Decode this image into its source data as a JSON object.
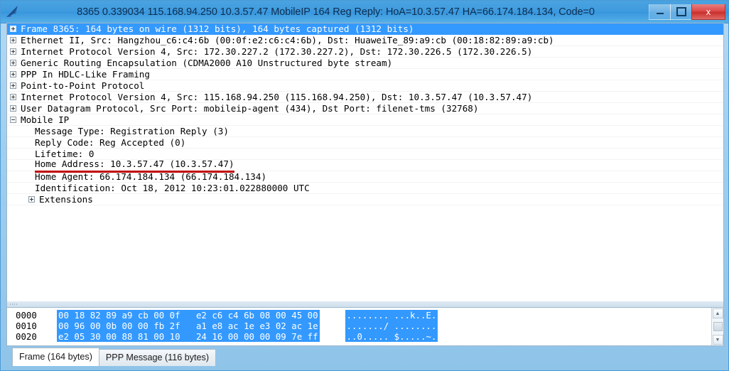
{
  "window": {
    "title": "8365 0.339034 115.168.94.250 10.3.57.47 MobileIP 164 Reg Reply: HoA=10.3.57.47 HA=66.174.184.134, Code=0",
    "app_icon": "wireshark-shark-fin-icon",
    "buttons": {
      "minimize": "minimize-icon",
      "maximize": "maximize-icon",
      "close": "x"
    },
    "accent_color": "#3795dc",
    "selection_color": "#3399ff",
    "close_color": "#c9302c",
    "annotation_color": "#c00000"
  },
  "tree": {
    "rows": [
      {
        "label": "Frame 8365: 164 bytes on wire (1312 bits), 164 bytes captured (1312 bits)",
        "expander": "plus",
        "indent": 1,
        "selected": true,
        "name": "tree-row-frame"
      },
      {
        "label": "Ethernet II, Src: Hangzhou_c6:c4:6b (00:0f:e2:c6:c4:6b), Dst: HuaweiTe_89:a9:cb (00:18:82:89:a9:cb)",
        "expander": "plus",
        "indent": 1,
        "selected": false,
        "name": "tree-row-ethernet"
      },
      {
        "label": "Internet Protocol Version 4, Src: 172.30.227.2 (172.30.227.2), Dst: 172.30.226.5 (172.30.226.5)",
        "expander": "plus",
        "indent": 1,
        "selected": false,
        "name": "tree-row-ipv4-outer"
      },
      {
        "label": "Generic Routing Encapsulation (CDMA2000 A10 Unstructured byte stream)",
        "expander": "plus",
        "indent": 1,
        "selected": false,
        "name": "tree-row-gre"
      },
      {
        "label": "PPP In HDLC-Like Framing",
        "expander": "plus",
        "indent": 1,
        "selected": false,
        "name": "tree-row-ppp-hdlc"
      },
      {
        "label": "Point-to-Point Protocol",
        "expander": "plus",
        "indent": 1,
        "selected": false,
        "name": "tree-row-ppp"
      },
      {
        "label": "Internet Protocol Version 4, Src: 115.168.94.250 (115.168.94.250), Dst: 10.3.57.47 (10.3.57.47)",
        "expander": "plus",
        "indent": 1,
        "selected": false,
        "name": "tree-row-ipv4-inner"
      },
      {
        "label": "User Datagram Protocol, Src Port: mobileip-agent (434), Dst Port: filenet-tms (32768)",
        "expander": "plus",
        "indent": 1,
        "selected": false,
        "name": "tree-row-udp"
      },
      {
        "label": "Mobile IP",
        "expander": "minus",
        "indent": 1,
        "selected": false,
        "name": "tree-row-mobile-ip"
      },
      {
        "label": "Message Type: Registration Reply (3)",
        "expander": "none",
        "indent": 2,
        "selected": false,
        "name": "tree-row-message-type"
      },
      {
        "label": "Reply Code: Reg Accepted (0)",
        "expander": "none",
        "indent": 2,
        "selected": false,
        "name": "tree-row-reply-code"
      },
      {
        "label": "Lifetime: 0",
        "expander": "none",
        "indent": 2,
        "selected": false,
        "name": "tree-row-lifetime"
      },
      {
        "label": "Home Address: 10.3.57.47 (10.3.57.47)",
        "expander": "none",
        "indent": 2,
        "selected": false,
        "annotated": true,
        "name": "tree-row-home-address"
      },
      {
        "label": "Home Agent: 66.174.184.134 (66.174.184.134)",
        "expander": "none",
        "indent": 2,
        "selected": false,
        "name": "tree-row-home-agent"
      },
      {
        "label": "Identification: Oct 18, 2012 10:23:01.022880000 UTC",
        "expander": "none",
        "indent": 2,
        "selected": false,
        "name": "tree-row-identification"
      },
      {
        "label": "Extensions",
        "expander": "plus",
        "indent": 3,
        "selected": false,
        "name": "tree-row-extensions"
      }
    ]
  },
  "hex": {
    "lines": [
      {
        "offset": "0000",
        "bytes": "00 18 82 89 a9 cb 00 0f   e2 c6 c4 6b 08 00 45 00",
        "ascii": "........ ...k..E."
      },
      {
        "offset": "0010",
        "bytes": "00 96 00 0b 00 00 fb 2f   a1 e8 ac 1e e3 02 ac 1e",
        "ascii": "......./ ........"
      },
      {
        "offset": "0020",
        "bytes": "e2 05 30 00 88 81 00 10   24 16 00 00 00 09 7e ff",
        "ascii": "..0..... $.....~."
      }
    ],
    "scrollbar": {
      "up": "▲",
      "down": "▼"
    }
  },
  "tabs": [
    {
      "label": "Frame (164 bytes)",
      "active": true,
      "name": "tab-frame"
    },
    {
      "label": "PPP Message (116 bytes)",
      "active": false,
      "name": "tab-ppp-message"
    }
  ]
}
